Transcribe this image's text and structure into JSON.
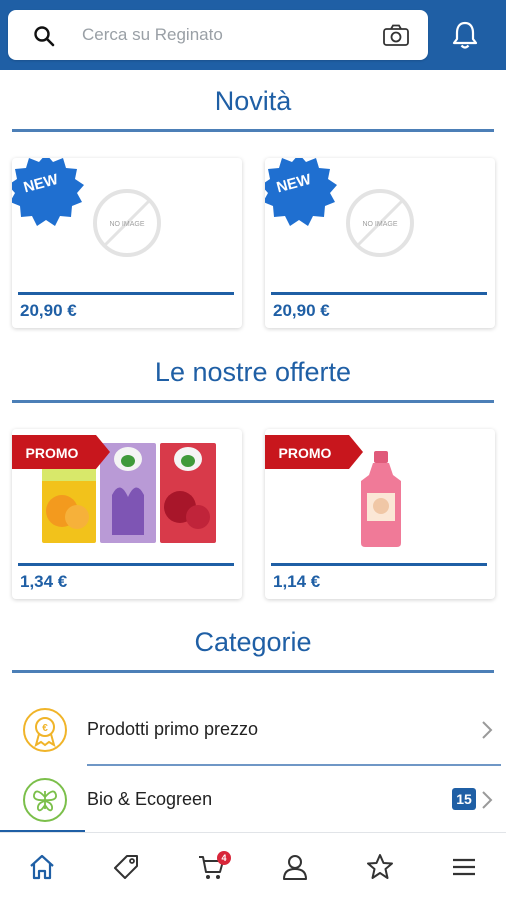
{
  "header": {
    "search_placeholder": "Cerca su Reginato",
    "icons": [
      "search-icon",
      "camera-icon",
      "bell-icon"
    ],
    "brand_color": "#1f5fa5"
  },
  "novita": {
    "title": "Novità",
    "products": [
      {
        "badge": "NEW",
        "image_text": "NO IMAGE",
        "price": "20,90 €"
      },
      {
        "badge": "NEW",
        "image_text": "NO IMAGE",
        "price": "20,90 €"
      }
    ]
  },
  "offerte": {
    "title": "Le nostre offerte",
    "products": [
      {
        "badge": "PROMO",
        "price": "1,34 €",
        "image": "air-wick-refills"
      },
      {
        "badge": "PROMO",
        "price": "1,14 €",
        "image": "pink-detergent-bottle"
      }
    ]
  },
  "categorie": {
    "title": "Categorie",
    "items": [
      {
        "label": "Prodotti primo prezzo",
        "icon": "coin-badge-icon",
        "count": null
      },
      {
        "label": "Bio & Ecogreen",
        "icon": "butterfly-icon",
        "count": "15"
      }
    ]
  },
  "bottom_nav": {
    "items": [
      "home-icon",
      "tag-icon",
      "cart-icon",
      "user-icon",
      "star-icon",
      "menu-icon"
    ],
    "cart_count": "4",
    "active": "home-icon"
  }
}
